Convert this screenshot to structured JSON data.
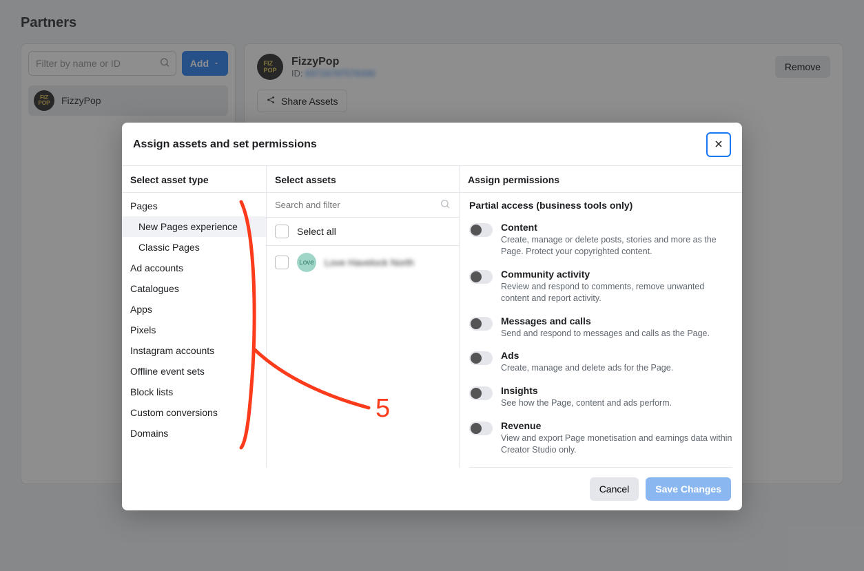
{
  "page": {
    "title": "Partners"
  },
  "sidebar": {
    "filter_placeholder": "Filter by name or ID",
    "add_label": "Add",
    "partner_name": "FizzyPop"
  },
  "detail": {
    "name": "FizzyPop",
    "id_label": "ID: ",
    "id_value": "63716797576330",
    "remove_label": "Remove",
    "share_assets_label": "Share Assets"
  },
  "modal": {
    "title": "Assign assets and set permissions",
    "col_type_title": "Select asset type",
    "col_assets_title": "Select assets",
    "col_perms_title": "Assign permissions",
    "asset_types": {
      "pages": "Pages",
      "pages_new": "New Pages experience",
      "pages_classic": "Classic Pages",
      "ad_accounts": "Ad accounts",
      "catalogues": "Catalogues",
      "apps": "Apps",
      "pixels": "Pixels",
      "instagram": "Instagram accounts",
      "offline": "Offline event sets",
      "blocklists": "Block lists",
      "custom": "Custom conversions",
      "domains": "Domains"
    },
    "assets": {
      "search_placeholder": "Search and filter",
      "select_all": "Select all",
      "item_label": "Love Havelock North"
    },
    "permissions": {
      "section_title": "Partial access (business tools only)",
      "content": {
        "label": "Content",
        "desc": "Create, manage or delete posts, stories and more as the Page. Protect your copyrighted content."
      },
      "community": {
        "label": "Community activity",
        "desc": "Review and respond to comments, remove unwanted content and report activity."
      },
      "messages": {
        "label": "Messages and calls",
        "desc": "Send and respond to messages and calls as the Page."
      },
      "ads": {
        "label": "Ads",
        "desc": "Create, manage and delete ads for the Page."
      },
      "insights": {
        "label": "Insights",
        "desc": "See how the Page, content and ads perform."
      },
      "revenue": {
        "label": "Revenue",
        "desc": "View and export Page monetisation and earnings data within Creator Studio only."
      }
    },
    "footer": {
      "cancel": "Cancel",
      "save": "Save Changes"
    }
  },
  "annotation": {
    "number": "5"
  }
}
